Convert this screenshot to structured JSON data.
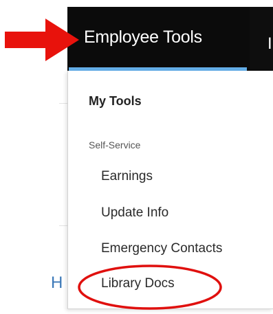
{
  "navbar": {
    "active_tab": "Employee Tools",
    "next_tab_partial": "I"
  },
  "background": {
    "peek_text": "H"
  },
  "dropdown": {
    "heading": "My Tools",
    "section_label": "Self-Service",
    "items": [
      {
        "label": "Earnings"
      },
      {
        "label": "Update Info"
      },
      {
        "label": "Emergency Contacts"
      },
      {
        "label": "Library Docs"
      }
    ]
  },
  "annotations": {
    "arrow_color": "#e8120c",
    "circle_color": "#e0100e",
    "underline_color": "#64aee8"
  }
}
